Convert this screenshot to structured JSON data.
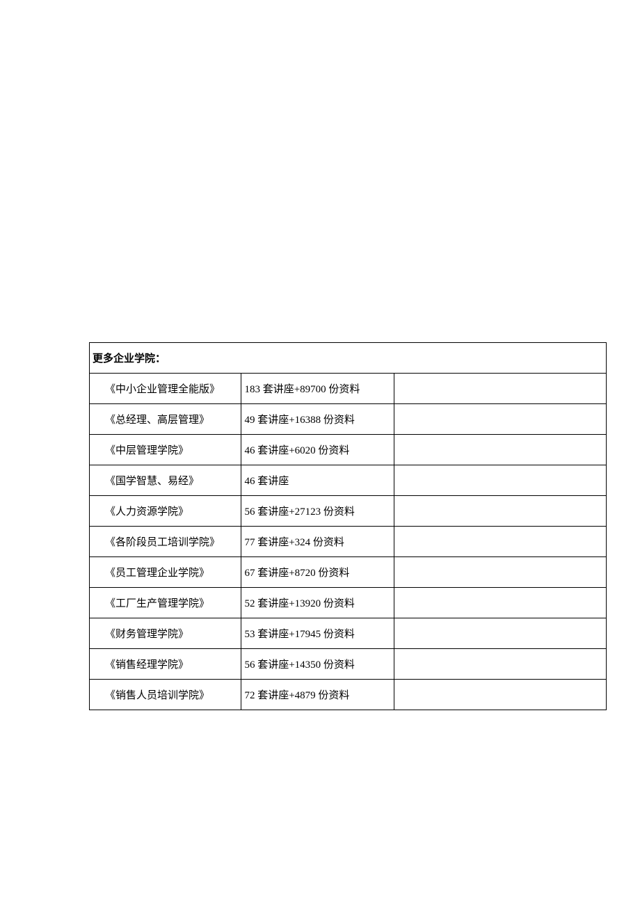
{
  "header": "更多企业学院：",
  "rows": [
    {
      "name": "《中小企业管理全能版》",
      "desc": "183 套讲座+89700 份资料"
    },
    {
      "name": "《总经理、高层管理》",
      "desc": "49 套讲座+16388 份资料"
    },
    {
      "name": "《中层管理学院》",
      "desc": "46 套讲座+6020 份资料"
    },
    {
      "name": "《国学智慧、易经》",
      "desc": "46 套讲座"
    },
    {
      "name": "《人力资源学院》",
      "desc": "56 套讲座+27123 份资料"
    },
    {
      "name": "《各阶段员工培训学院》",
      "desc": "77 套讲座+324 份资料"
    },
    {
      "name": "《员工管理企业学院》",
      "desc": "67 套讲座+8720 份资料"
    },
    {
      "name": "《工厂生产管理学院》",
      "desc": "52 套讲座+13920 份资料"
    },
    {
      "name": "《财务管理学院》",
      "desc": "53 套讲座+17945 份资料"
    },
    {
      "name": "《销售经理学院》",
      "desc": "56 套讲座+14350 份资料"
    },
    {
      "name": "《销售人员培训学院》",
      "desc": "72 套讲座+4879 份资料"
    }
  ]
}
